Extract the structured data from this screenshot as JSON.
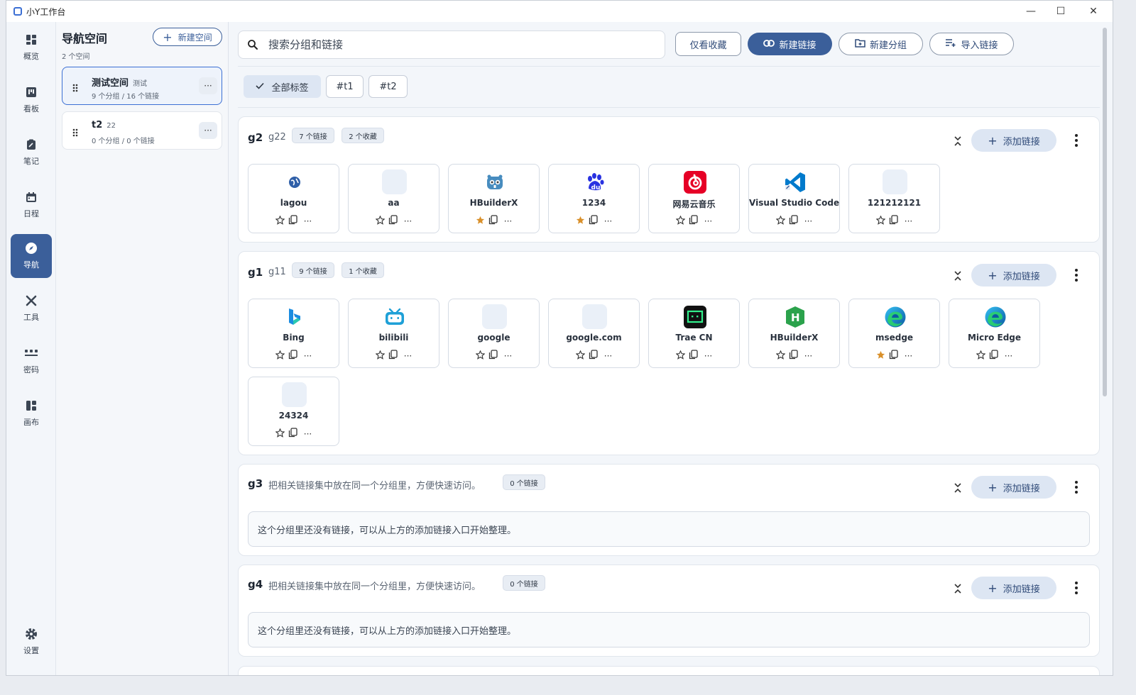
{
  "app": {
    "title": "小Y工作台"
  },
  "window_controls": {
    "minimize": "—",
    "maximize": "☐",
    "close": "✕"
  },
  "rail": {
    "items": [
      {
        "label": "概览",
        "icon": "dashboard-icon"
      },
      {
        "label": "看板",
        "icon": "kanban-icon"
      },
      {
        "label": "笔记",
        "icon": "note-icon"
      },
      {
        "label": "日程",
        "icon": "calendar-icon"
      },
      {
        "label": "导航",
        "icon": "compass-icon",
        "active": true
      },
      {
        "label": "工具",
        "icon": "tools-icon"
      },
      {
        "label": "密码",
        "icon": "password-icon"
      },
      {
        "label": "画布",
        "icon": "canvas-icon"
      }
    ],
    "settings_label": "设置"
  },
  "spaces": {
    "title": "导航空间",
    "count": "2 个空间",
    "new_space_label": "新建空间",
    "items": [
      {
        "name": "测试空间",
        "tag": "测试",
        "meta": "9 个分组 / 16 个链接",
        "active": true
      },
      {
        "name": "t2",
        "tag": "22",
        "meta": "0 个分组 / 0 个链接",
        "active": false
      }
    ]
  },
  "toolbar": {
    "search_placeholder": "搜索分组和链接",
    "favorites_only": "仅看收藏",
    "new_link": "新建链接",
    "new_group": "新建分组",
    "import_links": "导入链接"
  },
  "tags": {
    "all": "全部标签",
    "t1": "#t1",
    "t2": "#t2"
  },
  "groups": [
    {
      "name": "g2",
      "desc": "g22",
      "link_count": "7 个链接",
      "fav_count": "2 个收藏",
      "add_label": "添加链接",
      "links": [
        {
          "name": "lagou",
          "icon": "globe-icon",
          "fav": false
        },
        {
          "name": "aa",
          "icon": "blank-icon",
          "fav": false
        },
        {
          "name": "HBuilderX",
          "icon": "godot-icon",
          "fav": true
        },
        {
          "name": "1234",
          "icon": "baidu-icon",
          "fav": true
        },
        {
          "name": "网易云音乐",
          "icon": "netease-music-icon",
          "fav": false
        },
        {
          "name": "Visual Studio Code",
          "icon": "vscode-icon",
          "fav": false
        },
        {
          "name": "121212121",
          "icon": "blank-icon",
          "fav": false
        }
      ]
    },
    {
      "name": "g1",
      "desc": "g11",
      "link_count": "9 个链接",
      "fav_count": "1 个收藏",
      "add_label": "添加链接",
      "links": [
        {
          "name": "Bing",
          "icon": "bing-icon",
          "fav": false
        },
        {
          "name": "bilibili",
          "icon": "bilibili-icon",
          "fav": false
        },
        {
          "name": "google",
          "icon": "blank-icon",
          "fav": false
        },
        {
          "name": "google.com",
          "icon": "blank-icon",
          "fav": false
        },
        {
          "name": "Trae CN",
          "icon": "trae-icon",
          "fav": false
        },
        {
          "name": "HBuilderX",
          "icon": "hbuilderx-icon",
          "fav": false
        },
        {
          "name": "msedge",
          "icon": "edge-icon",
          "fav": true
        },
        {
          "name": "Micro Edge",
          "icon": "edge-icon",
          "fav": false
        },
        {
          "name": "24324",
          "icon": "blank-icon",
          "fav": false
        }
      ]
    },
    {
      "name": "g3",
      "desc": "把相关链接集中放在同一个分组里，方便快速访问。",
      "link_count": "0 个链接",
      "add_label": "添加链接",
      "empty_text": "这个分组里还没有链接，可以从上方的添加链接入口开始整理。"
    },
    {
      "name": "g4",
      "desc": "把相关链接集中放在同一个分组里，方便快速访问。",
      "link_count": "0 个链接",
      "add_label": "添加链接",
      "empty_text": "这个分组里还没有链接，可以从上方的添加链接入口开始整理。"
    }
  ],
  "colors": {
    "primary": "#3b5f9a",
    "accent_light": "#dde6f3",
    "star_fav": "#d9902b"
  }
}
